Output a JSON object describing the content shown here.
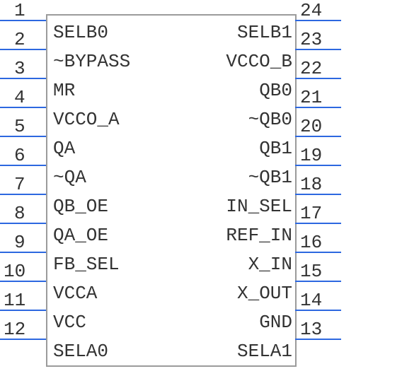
{
  "left_pins": [
    {
      "num": "1",
      "label": "SELB0"
    },
    {
      "num": "2",
      "label": "~BYPASS"
    },
    {
      "num": "3",
      "label": "MR"
    },
    {
      "num": "4",
      "label": "VCCO_A"
    },
    {
      "num": "5",
      "label": "QA"
    },
    {
      "num": "6",
      "label": "~QA"
    },
    {
      "num": "7",
      "label": "QB_OE"
    },
    {
      "num": "8",
      "label": "QA_OE"
    },
    {
      "num": "9",
      "label": "FB_SEL"
    },
    {
      "num": "10",
      "label": "VCCA"
    },
    {
      "num": "11",
      "label": "VCC"
    },
    {
      "num": "12",
      "label": "SELA0"
    }
  ],
  "right_pins": [
    {
      "num": "24",
      "label": "SELB1"
    },
    {
      "num": "23",
      "label": "VCCO_B"
    },
    {
      "num": "22",
      "label": "QB0"
    },
    {
      "num": "21",
      "label": "~QB0"
    },
    {
      "num": "20",
      "label": "QB1"
    },
    {
      "num": "19",
      "label": "~QB1"
    },
    {
      "num": "18",
      "label": "IN_SEL"
    },
    {
      "num": "17",
      "label": "REF_IN"
    },
    {
      "num": "16",
      "label": "X_IN"
    },
    {
      "num": "15",
      "label": "X_OUT"
    },
    {
      "num": "14",
      "label": "GND"
    },
    {
      "num": "13",
      "label": "SELA1"
    }
  ]
}
